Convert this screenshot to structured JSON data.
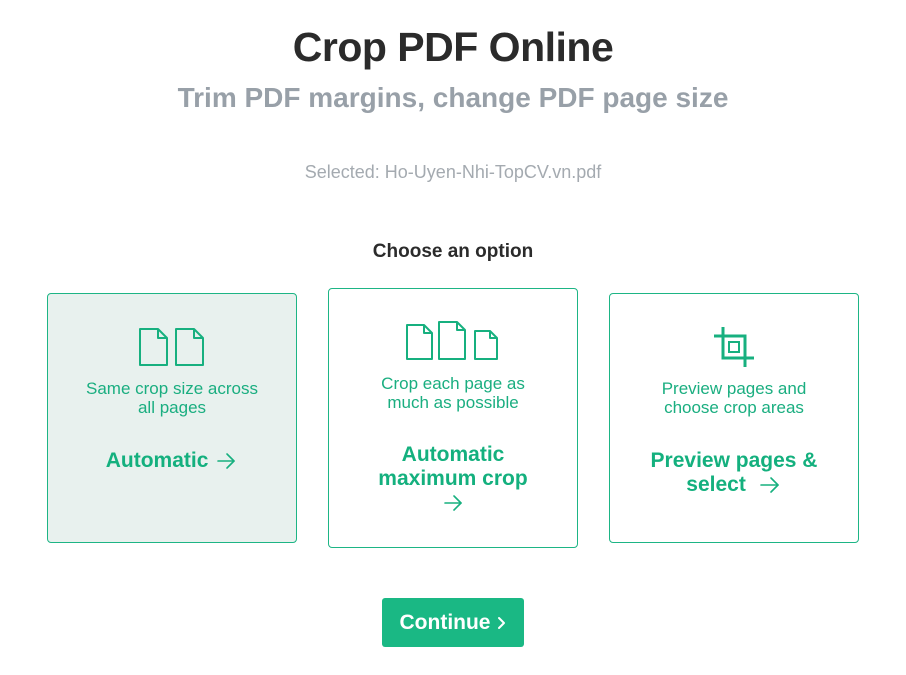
{
  "header": {
    "title": "Crop PDF Online",
    "subtitle": "Trim PDF margins, change PDF page size"
  },
  "file": {
    "selected_text": "Selected: Ho-Uyen-Nhi-TopCV.vn.pdf"
  },
  "options": {
    "heading": "Choose an option",
    "items": [
      {
        "description_line1": "Same crop size across",
        "description_line2": "all pages",
        "action_line1": "Automatic",
        "action_line2": "",
        "icon": "two-pages-icon",
        "selected": true
      },
      {
        "description_line1": "Crop each page as",
        "description_line2": "much as possible",
        "action_line1": "Automatic",
        "action_line2": "maximum crop",
        "icon": "three-pages-icon",
        "selected": false
      },
      {
        "description_line1": "Preview pages and",
        "description_line2": "choose crop areas",
        "action_line1": "Preview pages &",
        "action_line2": "select",
        "icon": "crop-icon",
        "selected": false
      }
    ]
  },
  "footer": {
    "continue_label": "Continue",
    "continue_icon": "chevron-right-icon"
  },
  "colors": {
    "accent": "#1ab884",
    "selected_card_bg": "#e8f1ee",
    "title": "#2b2b2b",
    "subtitle": "#98a0a8"
  }
}
